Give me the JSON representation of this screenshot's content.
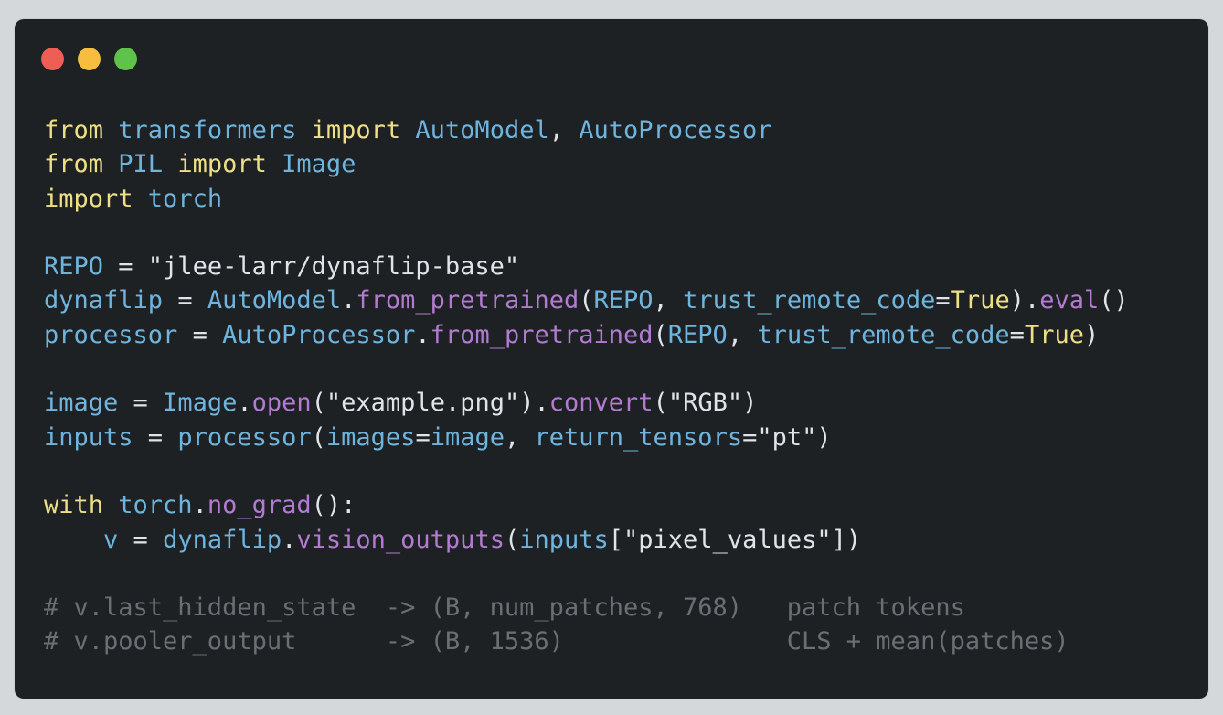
{
  "window": {
    "buttons": {
      "close_color": "#ee5e55",
      "minimize_color": "#f6bd3e",
      "maximize_color": "#5fc24a"
    }
  },
  "colors": {
    "background": "#1e2124",
    "keyword": "#eedf86",
    "identifier": "#6eb4dd",
    "function": "#b27ad0",
    "string": "#dfe4e8",
    "comment": "#6b6f73"
  },
  "code": {
    "lines": [
      [
        [
          "kw",
          "from"
        ],
        [
          "id",
          " transformers "
        ],
        [
          "kw",
          "import"
        ],
        [
          "id",
          " AutoModel"
        ],
        [
          "pun",
          ", "
        ],
        [
          "id",
          "AutoProcessor"
        ]
      ],
      [
        [
          "kw",
          "from"
        ],
        [
          "id",
          " PIL "
        ],
        [
          "kw",
          "import"
        ],
        [
          "id",
          " Image"
        ]
      ],
      [
        [
          "kw",
          "import"
        ],
        [
          "id",
          " torch"
        ]
      ],
      [],
      [
        [
          "id",
          "REPO "
        ],
        [
          "pun",
          "= "
        ],
        [
          "str",
          "\"jlee-larr/dynaflip-base\""
        ]
      ],
      [
        [
          "id",
          "dynaflip "
        ],
        [
          "pun",
          "= "
        ],
        [
          "id",
          "AutoModel"
        ],
        [
          "pun",
          "."
        ],
        [
          "fn",
          "from_pretrained"
        ],
        [
          "pun",
          "("
        ],
        [
          "id",
          "REPO"
        ],
        [
          "pun",
          ", "
        ],
        [
          "id",
          "trust_remote_code"
        ],
        [
          "pun",
          "="
        ],
        [
          "kw",
          "True"
        ],
        [
          "pun",
          ")."
        ],
        [
          "fn",
          "eval"
        ],
        [
          "pun",
          "()"
        ]
      ],
      [
        [
          "id",
          "processor "
        ],
        [
          "pun",
          "= "
        ],
        [
          "id",
          "AutoProcessor"
        ],
        [
          "pun",
          "."
        ],
        [
          "fn",
          "from_pretrained"
        ],
        [
          "pun",
          "("
        ],
        [
          "id",
          "REPO"
        ],
        [
          "pun",
          ", "
        ],
        [
          "id",
          "trust_remote_code"
        ],
        [
          "pun",
          "="
        ],
        [
          "kw",
          "True"
        ],
        [
          "pun",
          ")"
        ]
      ],
      [],
      [
        [
          "id",
          "image "
        ],
        [
          "pun",
          "= "
        ],
        [
          "id",
          "Image"
        ],
        [
          "pun",
          "."
        ],
        [
          "fn",
          "open"
        ],
        [
          "pun",
          "("
        ],
        [
          "str",
          "\"example.png\""
        ],
        [
          "pun",
          ")."
        ],
        [
          "fn",
          "convert"
        ],
        [
          "pun",
          "("
        ],
        [
          "str",
          "\"RGB\""
        ],
        [
          "pun",
          ")"
        ]
      ],
      [
        [
          "id",
          "inputs "
        ],
        [
          "pun",
          "= "
        ],
        [
          "id",
          "processor"
        ],
        [
          "pun",
          "("
        ],
        [
          "id",
          "images"
        ],
        [
          "pun",
          "="
        ],
        [
          "id",
          "image"
        ],
        [
          "pun",
          ", "
        ],
        [
          "id",
          "return_tensors"
        ],
        [
          "pun",
          "="
        ],
        [
          "str",
          "\"pt\""
        ],
        [
          "pun",
          ")"
        ]
      ],
      [],
      [
        [
          "kw",
          "with"
        ],
        [
          "id",
          " torch"
        ],
        [
          "pun",
          "."
        ],
        [
          "fn",
          "no_grad"
        ],
        [
          "pun",
          "():"
        ]
      ],
      [
        [
          "id",
          "    v "
        ],
        [
          "pun",
          "= "
        ],
        [
          "id",
          "dynaflip"
        ],
        [
          "pun",
          "."
        ],
        [
          "fn",
          "vision_outputs"
        ],
        [
          "pun",
          "("
        ],
        [
          "id",
          "inputs"
        ],
        [
          "pun",
          "["
        ],
        [
          "str",
          "\"pixel_values\""
        ],
        [
          "pun",
          "])"
        ]
      ],
      [],
      [
        [
          "com",
          "# v.last_hidden_state  -> (B, num_patches, 768)   patch tokens"
        ]
      ],
      [
        [
          "com",
          "# v.pooler_output      -> (B, 1536)               CLS + mean(patches)"
        ]
      ]
    ]
  }
}
